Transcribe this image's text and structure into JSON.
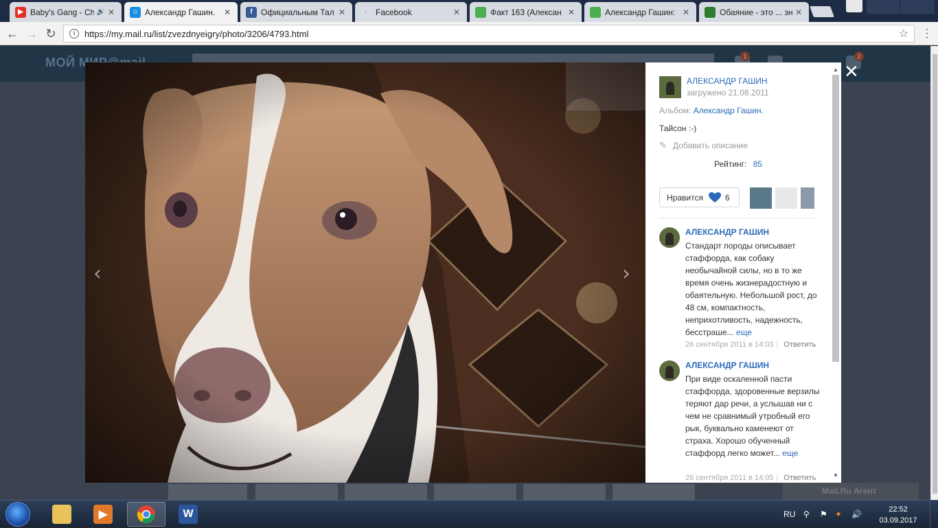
{
  "browser": {
    "tabs": [
      {
        "label": "Baby's Gang - Ch",
        "favicon_color": "#e52d27",
        "has_audio": true
      },
      {
        "label": "Александр Гашин.",
        "favicon_color": "#168de2",
        "active": true
      },
      {
        "label": "Официальным Тал",
        "favicon_color": "#3b5998"
      },
      {
        "label": "Facebook",
        "favicon_color": "#d8dde6"
      },
      {
        "label": "Факт 163 (Алексан",
        "favicon_color": "#4caf50"
      },
      {
        "label": "Александр Гашин:",
        "favicon_color": "#4caf50"
      },
      {
        "label": "Обаяние - это ... зн",
        "favicon_color": "#2e7d32"
      }
    ],
    "url": "https://my.mail.ru/list/zvezdnyeigry/photo/3206/4793.html"
  },
  "site": {
    "logo": "МОЙ МИР@mail",
    "agent_label": "Mail.Ru Агент"
  },
  "photo_panel": {
    "author": "АЛЕКСАНДР ГАШИН",
    "uploaded": "загружено 21.08.2011",
    "album_label": "Альбом:",
    "album_name": "Александр Гашин.",
    "description": "Тайсон :-)",
    "add_description": "Добавить описание",
    "rating_label": "Рейтинг:",
    "rating_value": "85",
    "like_label": "Нравится",
    "like_count": "6",
    "comments": [
      {
        "author": "АЛЕКСАНДР ГАШИН",
        "text": "Стандарт породы описывает стаффорда, как собаку необычайной силы, но в то же время очень жизнерадостную и обаятельную. Небольшой рост, до 48 см, компактность, неприхотливость, надежность, бесстраше...",
        "more": "еще",
        "date": "26 сентября 2011 в 14:03",
        "reply": "Ответить"
      },
      {
        "author": "АЛЕКСАНДР ГАШИН",
        "text": "При виде оскаленной пасти стаффорда, здоровенные верзилы теряют дар речи, а услышав ни с чем не сравнимый утробный его рык, буквально каменеют от страха. Хорошо обученный стаффорд легко может...",
        "more": "еще",
        "date": "26 сентября 2011 в 14:05",
        "reply": "Ответить"
      }
    ]
  },
  "taskbar": {
    "language": "RU",
    "time": "22:52",
    "date": "03.09.2017"
  },
  "colors": {
    "link": "#2a6ab8",
    "like_heart": "#2a6ab8"
  }
}
